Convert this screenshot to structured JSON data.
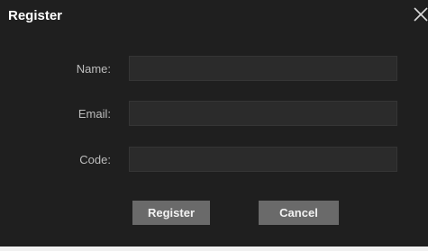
{
  "dialog": {
    "title": "Register",
    "close_icon": "close-icon"
  },
  "form": {
    "name": {
      "label": "Name:",
      "value": ""
    },
    "email": {
      "label": "Email:",
      "value": ""
    },
    "code": {
      "label": "Code:",
      "value": ""
    }
  },
  "buttons": {
    "register_label": "Register",
    "cancel_label": "Cancel"
  },
  "colors": {
    "background": "#1f1f1f",
    "field": "#2b2b2b",
    "button": "#6a6a6a"
  }
}
